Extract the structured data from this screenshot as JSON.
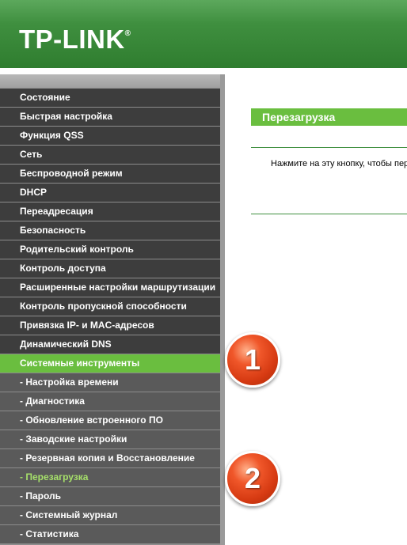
{
  "header": {
    "brand": "TP-LINK",
    "trademark": "®"
  },
  "sidebar": {
    "items": [
      {
        "label": "Состояние",
        "type": "main"
      },
      {
        "label": "Быстрая настройка",
        "type": "main"
      },
      {
        "label": "Функция QSS",
        "type": "main"
      },
      {
        "label": "Сеть",
        "type": "main"
      },
      {
        "label": "Беспроводной режим",
        "type": "main"
      },
      {
        "label": "DHCP",
        "type": "main"
      },
      {
        "label": "Переадресация",
        "type": "main"
      },
      {
        "label": "Безопасность",
        "type": "main"
      },
      {
        "label": "Родительский контроль",
        "type": "main"
      },
      {
        "label": "Контроль доступа",
        "type": "main"
      },
      {
        "label": "Расширенные настройки маршрутизации",
        "type": "main"
      },
      {
        "label": "Контроль пропускной способности",
        "type": "main"
      },
      {
        "label": "Привязка IP- и MAC-адресов",
        "type": "main"
      },
      {
        "label": "Динамический DNS",
        "type": "main"
      },
      {
        "label": "Системные инструменты",
        "type": "main",
        "state": "active"
      },
      {
        "label": "- Настройка времени",
        "type": "sub"
      },
      {
        "label": "- Диагностика",
        "type": "sub"
      },
      {
        "label": "- Обновление встроенного ПО",
        "type": "sub"
      },
      {
        "label": "- Заводские настройки",
        "type": "sub"
      },
      {
        "label": "- Резервная копия и Восстановление",
        "type": "sub"
      },
      {
        "label": "- Перезагрузка",
        "type": "sub",
        "state": "current"
      },
      {
        "label": "- Пароль",
        "type": "sub"
      },
      {
        "label": "- Системный журнал",
        "type": "sub"
      },
      {
        "label": "- Статистика",
        "type": "sub"
      }
    ]
  },
  "annotations": {
    "marker_1": "1",
    "marker_2": "2"
  },
  "main": {
    "title": "Перезагрузка",
    "description": "Нажмите на эту кнопку, чтобы перезагрузить устройство."
  },
  "colors": {
    "header_green": "#2f7d2f",
    "accent_green": "#6abe3f",
    "menu_dark": "#3d3d3d",
    "submenu_gray": "#5a5a5a",
    "current_text": "#a6e06a",
    "marker_orange": "#e0461c"
  }
}
